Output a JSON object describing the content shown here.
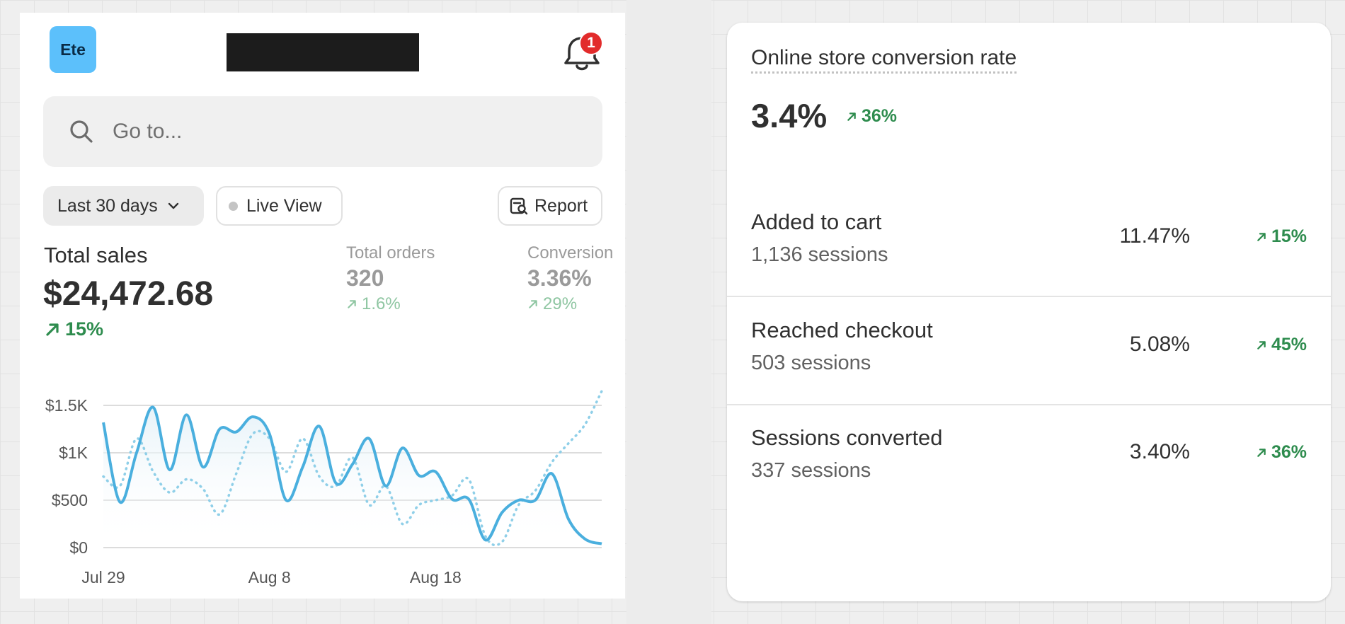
{
  "header": {
    "store_initials": "Ete",
    "notification_count": "1"
  },
  "search": {
    "placeholder": "Go to..."
  },
  "toolbar": {
    "date_range_label": "Last 30 days",
    "live_view_label": "Live View",
    "report_label": "Report"
  },
  "metrics": {
    "total_sales": {
      "label": "Total sales",
      "value": "$24,472.68",
      "change": "15%"
    },
    "total_orders": {
      "label": "Total orders",
      "value": "320",
      "change": "1.6%"
    },
    "conversion": {
      "label": "Conversion",
      "value": "3.36%",
      "change": "29%"
    }
  },
  "colors": {
    "accent_positive": "#2e8c4e",
    "chart_current": "#4aafde",
    "chart_previous": "#8fcfe8",
    "avatar": "#5cc0fb",
    "badge": "#e22b2b"
  },
  "chart_data": {
    "type": "line",
    "y_ticks": [
      "$1.5K",
      "$1K",
      "$500",
      "$0"
    ],
    "x_ticks": [
      "Jul 29",
      "Aug 8",
      "Aug 18"
    ],
    "ylim": [
      0,
      1500
    ],
    "grid": true,
    "x": [
      "Jul 29",
      "Jul 30",
      "Jul 31",
      "Aug 1",
      "Aug 2",
      "Aug 3",
      "Aug 4",
      "Aug 5",
      "Aug 6",
      "Aug 7",
      "Aug 8",
      "Aug 9",
      "Aug 10",
      "Aug 11",
      "Aug 12",
      "Aug 13",
      "Aug 14",
      "Aug 15",
      "Aug 16",
      "Aug 17",
      "Aug 18",
      "Aug 19",
      "Aug 20",
      "Aug 21",
      "Aug 22",
      "Aug 23",
      "Aug 24",
      "Aug 25",
      "Aug 26",
      "Aug 27",
      "Aug 28"
    ],
    "series": [
      {
        "style": "solid",
        "values": [
          1320,
          480,
          1000,
          1480,
          820,
          1400,
          850,
          1250,
          1220,
          1380,
          1200,
          500,
          850,
          1280,
          680,
          880,
          1150,
          650,
          1050,
          760,
          800,
          510,
          510,
          80,
          370,
          500,
          500,
          780,
          300,
          90,
          40
        ]
      },
      {
        "style": "dotted",
        "values": [
          750,
          650,
          1150,
          800,
          580,
          720,
          620,
          350,
          780,
          1200,
          1150,
          800,
          1150,
          750,
          650,
          950,
          450,
          650,
          250,
          450,
          500,
          550,
          720,
          120,
          60,
          450,
          600,
          900,
          1100,
          1300,
          1650
        ]
      }
    ]
  },
  "conversion_card": {
    "title": "Online store conversion rate",
    "rate": "3.4%",
    "change": "36%",
    "rows": [
      {
        "label": "Added to cart",
        "sessions": "1,136 sessions",
        "rate": "11.47%",
        "change": "15%"
      },
      {
        "label": "Reached checkout",
        "sessions": "503 sessions",
        "rate": "5.08%",
        "change": "45%"
      },
      {
        "label": "Sessions converted",
        "sessions": "337 sessions",
        "rate": "3.40%",
        "change": "36%"
      }
    ]
  }
}
